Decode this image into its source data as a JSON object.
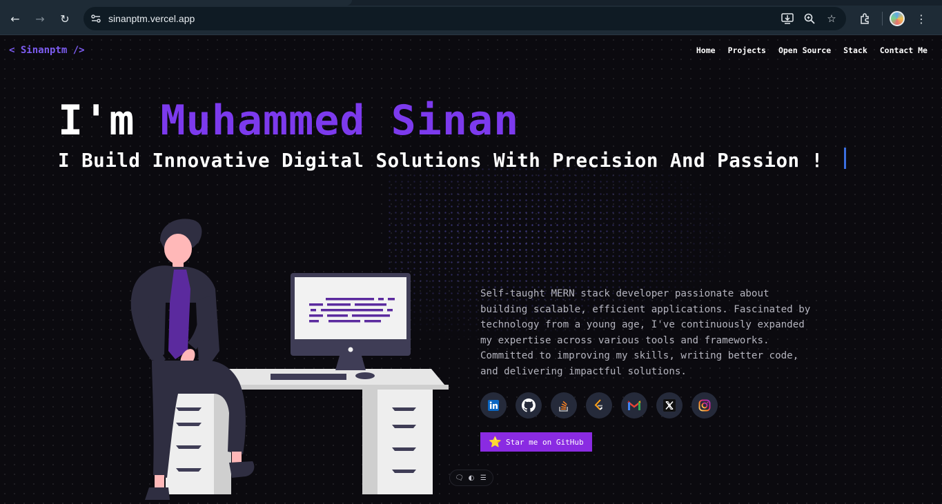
{
  "browser": {
    "url": "sinanptm.vercel.app",
    "nav_icons": [
      "back-arrow-icon",
      "forward-arrow-icon",
      "reload-icon"
    ],
    "omnibox_icons": [
      "install-app-icon",
      "zoom-icon",
      "bookmark-star-icon"
    ],
    "toolbar_icons": [
      "extensions-icon",
      "profile-avatar",
      "more-menu-icon"
    ]
  },
  "navbar": {
    "brand": "< Sinanptm />",
    "links": [
      "Home",
      "Projects",
      "Open Source",
      "Stack",
      "Contact Me"
    ]
  },
  "hero": {
    "greeting": "I'm ",
    "name": "Muhammed Sinan",
    "tagline": "I Build Innovative Digital Solutions With Precision And Passion !"
  },
  "about": {
    "bio": "Self-taught MERN stack developer passionate about\nbuilding scalable, efficient applications. Fascinated by\ntechnology from a young age, I've continuously expanded\nmy expertise across various tools and frameworks.\nCommitted to improving my skills, writing better code,\nand delivering impactful solutions."
  },
  "socials": [
    {
      "icon": "linkedin-icon"
    },
    {
      "icon": "github-icon"
    },
    {
      "icon": "stackoverflow-icon"
    },
    {
      "icon": "leetcode-icon"
    },
    {
      "icon": "gmail-icon"
    },
    {
      "icon": "x-twitter-icon"
    },
    {
      "icon": "instagram-icon"
    }
  ],
  "cta": {
    "star_label": "Star me on GitHub",
    "star_icon": "star-icon"
  },
  "floating_toolbar": {
    "icons": [
      "comment-icon",
      "toggle-icon",
      "menu-icon"
    ]
  },
  "colors": {
    "accent": "#7c3aed",
    "button": "#8a2be2",
    "background": "#0b0a0f"
  }
}
